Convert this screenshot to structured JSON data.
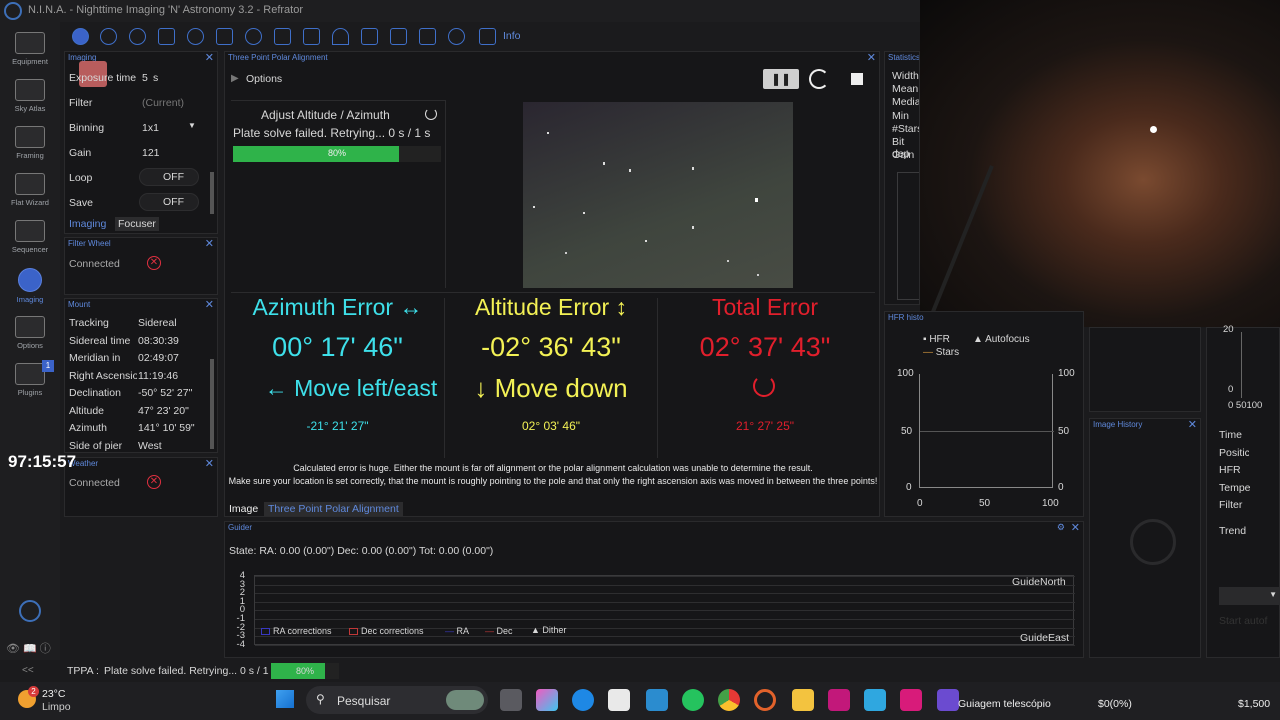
{
  "window": {
    "title": "N.I.N.A. - Nighttime Imaging 'N' Astronomy 3.2 - Refrator"
  },
  "sidebar": {
    "items": [
      {
        "label": "Equipment"
      },
      {
        "label": "Sky Atlas"
      },
      {
        "label": "Framing"
      },
      {
        "label": "Flat Wizard"
      },
      {
        "label": "Sequencer"
      },
      {
        "label": "Imaging"
      },
      {
        "label": "Options"
      },
      {
        "label": "Plugins"
      }
    ],
    "plugins_badge": "1",
    "collapse": "<<"
  },
  "toolbar": {
    "info_label": "Info"
  },
  "imaging_panel": {
    "title": "Imaging",
    "rows": [
      {
        "label": "Exposure time",
        "value": "5",
        "unit": "s"
      },
      {
        "label": "Filter",
        "value": "(Current)"
      },
      {
        "label": "Binning",
        "value": "1x1"
      },
      {
        "label": "Gain",
        "value": "121"
      },
      {
        "label": "Loop",
        "value": "OFF"
      },
      {
        "label": "Save",
        "value": "OFF"
      }
    ],
    "tabs": [
      "Imaging",
      "Focuser"
    ]
  },
  "filter_wheel": {
    "title": "Filter Wheel",
    "status": "Connected"
  },
  "mount": {
    "title": "Mount",
    "rows": [
      {
        "label": "Tracking",
        "value": "Sidereal"
      },
      {
        "label": "Sidereal time",
        "value": "08:30:39"
      },
      {
        "label": "Meridian in",
        "value": "02:49:07"
      },
      {
        "label": "Right Ascension",
        "value": "11:19:46"
      },
      {
        "label": "Declination",
        "value": "-50° 52' 27\""
      },
      {
        "label": "Altitude",
        "value": "47° 23' 20\""
      },
      {
        "label": "Azimuth",
        "value": "141° 10' 59\""
      },
      {
        "label": "Side of pier",
        "value": "West"
      }
    ]
  },
  "weather": {
    "title": "Weather",
    "status": "Connected"
  },
  "overlay_timer": "97:15:57",
  "tppa": {
    "title": "Three Point Polar Alignment",
    "options_label": "Options",
    "step": "Adjust Altitude / Azimuth",
    "status": "Plate solve failed. Retrying... 0 s / 1 s",
    "progress_label": "80%",
    "progress": 0.8,
    "azimuth": {
      "title": "Azimuth Error",
      "icon": "↔",
      "value": "00° 17' 46\"",
      "direction": "← Move left/east",
      "sub": "-21° 21' 27\""
    },
    "altitude": {
      "title": "Altitude Error",
      "icon": "↕",
      "value": "-02° 36' 43\"",
      "direction": "↓ Move down",
      "sub": "02° 03' 46\""
    },
    "total": {
      "title": "Total Error",
      "value": "02° 37' 43\"",
      "sub": "21° 27' 25\""
    },
    "message1": "Calculated error is huge. Either the mount is far off alignment or the polar alignment calculation was unable to determine the result.",
    "message2": "Make sure your location is set correctly, that the mount is roughly pointing to the pole and that only the right ascension axis was moved in between the three points!",
    "tabs": [
      "Image",
      "Three Point Polar Alignment"
    ]
  },
  "statistics": {
    "title": "Statistics",
    "rows": [
      "Width",
      "Mean",
      "Media",
      "Min",
      "#Stars",
      "Bit dep",
      "Gain"
    ]
  },
  "hfr_history": {
    "title": "HFR histo",
    "legend": [
      "HFR",
      "Autofocus",
      "Stars"
    ],
    "left_ticks": [
      "100",
      "50",
      "0"
    ],
    "right_ticks": [
      "100",
      "50",
      "0"
    ],
    "x_ticks": [
      "0",
      "50",
      "100"
    ]
  },
  "image_history": {
    "title": "Image History"
  },
  "right_panel": {
    "tick_top": "20",
    "tick_bottom": "0",
    "x_ticks": "0 50100",
    "rows": [
      "Time",
      "Positic",
      "HFR",
      "Tempe",
      "Filter",
      "Trend"
    ],
    "button": "Start autof"
  },
  "guider": {
    "title": "Guider",
    "state": "State:  RA: 0.00 (0.00\")  Dec: 0.00 (0.00\")  Tot: 0.00 (0.00\")",
    "y_ticks": [
      "4",
      "3",
      "2",
      "1",
      "0",
      "-1",
      "-2",
      "-3",
      "-4"
    ],
    "north": "GuideNorth",
    "east": "GuideEast",
    "legend": [
      "RA corrections",
      "Dec corrections",
      "RA",
      "Dec",
      "Dither"
    ]
  },
  "statusbar": {
    "label": "TPPA :",
    "text": "Plate solve failed. Retrying... 0 s / 1 s",
    "progress_label": "80%"
  },
  "taskbar": {
    "temp": "23°C",
    "weather": "Limpo",
    "weather_badge": "2",
    "search": "Pesquisar",
    "active_app": "Guiagem telescópio",
    "stock1": "$0(0%)",
    "stock2": "$1,500"
  },
  "colors": {
    "accent": "#3b63c9",
    "cyan": "#3ee0ea",
    "yellow": "#f3f155",
    "red": "#e11f2c",
    "progress": "#2fb34a"
  }
}
